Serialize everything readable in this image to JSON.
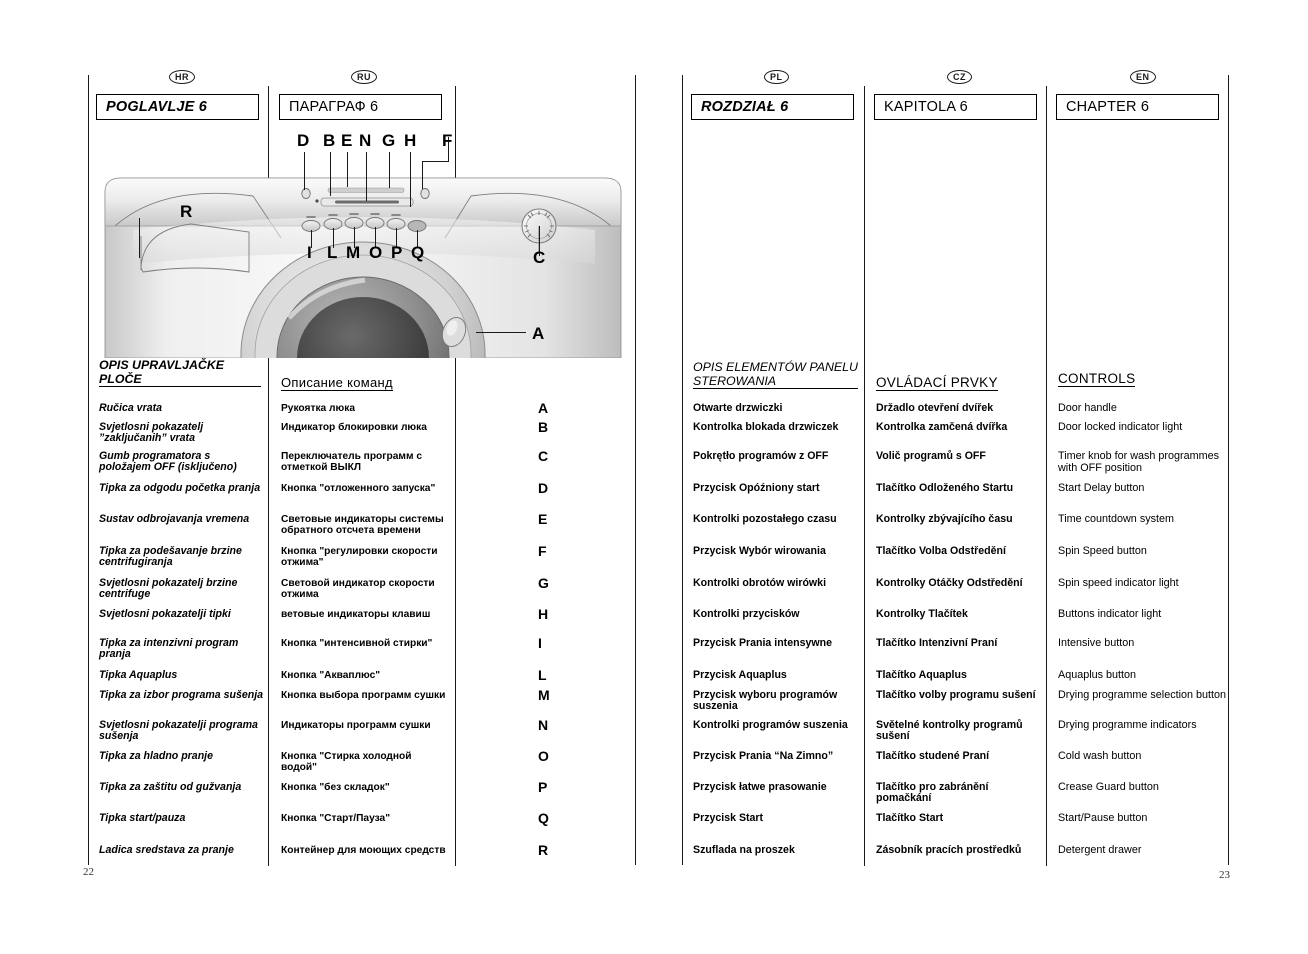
{
  "document": {
    "left_page_number": "22",
    "right_page_number": "23"
  },
  "language_badges": {
    "hr": "HR",
    "ru": "RU",
    "pl": "PL",
    "cz": "CZ",
    "en": "EN"
  },
  "chapter_boxes": {
    "hr": "POGLAVLJE 6",
    "ru": "ПАРАГРАФ 6",
    "pl": "ROZDZIAŁ 6",
    "cz": "KAPITOLA 6",
    "en": "CHAPTER 6"
  },
  "illustration": {
    "name": "washing-machine-control-panel",
    "callouts": [
      "D",
      "B",
      "E",
      "N",
      "G",
      "H",
      "F",
      "R",
      "I",
      "L",
      "M",
      "O",
      "P",
      "Q",
      "C",
      "A"
    ],
    "callout_top_row": [
      "D",
      "B",
      "E",
      "N",
      "G",
      "H",
      "F"
    ],
    "callout_button_row": [
      "I",
      "L",
      "M",
      "O",
      "P",
      "Q"
    ],
    "callout_left": "R",
    "callout_knob": "C",
    "callout_handle": "A"
  },
  "key_letters": [
    "A",
    "B",
    "C",
    "D",
    "E",
    "F",
    "G",
    "H",
    "I",
    "L",
    "M",
    "N",
    "O",
    "P",
    "Q",
    "R"
  ],
  "columns": {
    "hr": {
      "heading": "OPIS UPRAVLJAČKE PLOČE",
      "items": [
        "Ručica vrata",
        "Svjetlosni pokazatelj ”zaključanih” vrata",
        "Gumb programatora s položajem OFF (isključeno)",
        "Tipka za odgodu početka pranja",
        "Sustav odbrojavanja vremena",
        "Tipka za podešavanje brzine centrifugiranja",
        "Svjetlosni pokazatelj brzine centrifuge",
        "Svjetlosni pokazatelji tipki",
        "Tipka za intenzivni program pranja",
        "Tipka Aquaplus",
        "Tipka za izbor programa sušenja",
        "Svjetlosni pokazatelji programa sušenja",
        "Tipka za hladno pranje",
        "Tipka za zaštitu od gužvanja",
        "Tipka start/pauza",
        "Ladica sredstava za pranje"
      ]
    },
    "ru": {
      "heading": "Описание команд",
      "items": [
        "Рукоятка люка",
        "Индикатор блокировки люка",
        "Переключатель программ с отметкой ВЫКЛ",
        "Кнопка \"отложенного запуска\"",
        "Световые индикаторы системы обратного отсчета времени",
        "Кнопка \"регулировки скорости отжима\"",
        "Световой индикатор скорости отжима",
        "ветовые индикаторы клавиш",
        "Кнопка \"интенсивной стирки\"",
        "Кнопка \"Акваплюс\"",
        "Кнопка выбора программ сушки",
        "Индикаторы программ сушки",
        "Кнопка  \"Стирка холодной водой\"",
        "Кнопка \"без складок\"",
        "Кнопка \"Старт/Пауза\"",
        "Контейнер для моющих средств"
      ]
    },
    "pl": {
      "heading": "OPIS ELEMENTÓW PANELU STEROWANIA",
      "items": [
        "Otwarte drzwiczki",
        "Kontrolka blokada drzwiczek",
        "Pokrętło programów z OFF",
        "Przycisk Opóźniony start",
        "Kontrolki pozostałego czasu",
        "Przycisk Wybór wirowania",
        "Kontrolki obrotów wirówki",
        "Kontrolki przycisków",
        "Przycisk Prania intensywne",
        "Przycisk Aquaplus",
        "Przycisk wyboru programów suszenia",
        "Kontrolki programów suszenia",
        "Przycisk Prania “Na Zimno”",
        "Przycisk łatwe prasowanie",
        "Przycisk Start",
        "Szuflada na proszek"
      ]
    },
    "cz": {
      "heading": "OVLÁDACÍ PRVKY",
      "items": [
        "Držadlo otevření dvířek",
        "Kontrolka zamčená dvířka",
        "Volič programů s OFF",
        "Tlačítko Odloženého Startu",
        "Kontrolky zbývajícího času",
        "Tlačítko Volba Odstředění",
        "Kontrolky Otáčky Odstředění",
        "Kontrolky Tlačítek",
        "Tlačítko Intenzivní Praní",
        "Tlačítko Aquaplus",
        "Tlačítko volby programu sušení",
        "Světelné kontrolky programů sušení",
        "Tlačítko studené Praní",
        "Tlačítko pro zabránění pomačkání",
        "Tlačítko Start",
        "Zásobník pracích prostředků"
      ]
    },
    "en": {
      "heading": "CONTROLS",
      "items": [
        "Door handle",
        "Door locked indicator light",
        "Timer knob for wash programmes with OFF position",
        "Start Delay button",
        "Time countdown system",
        "Spin Speed button",
        "Spin speed indicator light",
        "Buttons indicator light",
        "Intensive button",
        "Aquaplus button",
        "Drying programme selection button",
        "Drying programme indicators",
        "Cold wash button",
        "Crease Guard button",
        "Start/Pause button",
        "Detergent drawer"
      ]
    }
  }
}
